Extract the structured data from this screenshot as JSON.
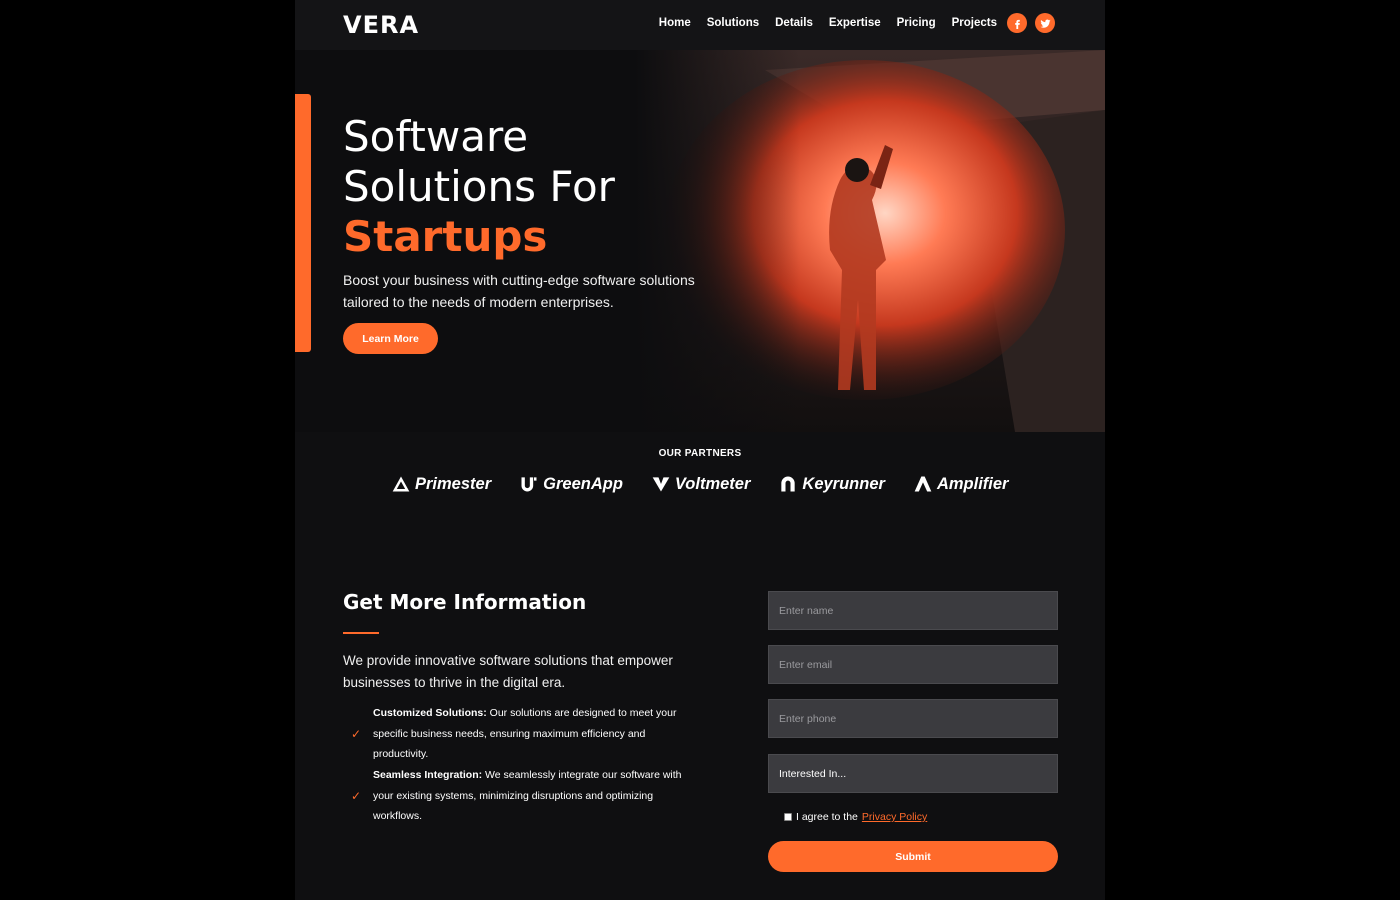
{
  "brand": {
    "logo": "VERA"
  },
  "nav": {
    "items": [
      "Home",
      "Solutions",
      "Details",
      "Expertise",
      "Pricing",
      "Projects"
    ],
    "social": [
      "facebook-icon",
      "twitter-icon"
    ]
  },
  "hero": {
    "title_line1": "Software",
    "title_line2": "Solutions For",
    "title_accent": "Startups",
    "subtitle": "Boost your business with cutting-edge software solutions tailored to the needs of modern enterprises.",
    "cta": "Learn More"
  },
  "partners": {
    "title": "OUR PARTNERS",
    "items": [
      "Primester",
      "GreenApp",
      "Voltmeter",
      "Keyrunner",
      "Amplifier"
    ]
  },
  "info": {
    "title": "Get More Information",
    "description": "We provide innovative software solutions that empower businesses to thrive in the digital era.",
    "features": [
      {
        "title": "Customized Solutions:",
        "text": "Our solutions are designed to meet your specific business needs, ensuring maximum efficiency and productivity."
      },
      {
        "title": "Seamless Integration:",
        "text": "We seamlessly integrate our software with your existing systems, minimizing disruptions and optimizing workflows."
      }
    ]
  },
  "form": {
    "name_placeholder": "Enter name",
    "email_placeholder": "Enter email",
    "phone_placeholder": "Enter phone",
    "interest": "Interested In...",
    "agree_prefix": "I agree to the",
    "privacy_link": "Privacy Policy",
    "submit": "Submit"
  },
  "colors": {
    "accent": "#ff6a2b",
    "page_bg": "#0f0f11",
    "field_bg": "#3b3b3f"
  }
}
